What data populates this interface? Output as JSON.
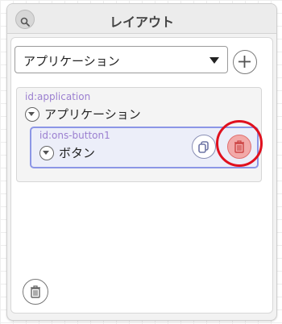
{
  "panel": {
    "title": "レイアウト",
    "search_icon": "search-icon"
  },
  "selector": {
    "selected": "アプリケーション",
    "add_icon": "plus-icon"
  },
  "tree": {
    "root": {
      "id_label": "id:application",
      "label": "アプリケーション"
    },
    "child": {
      "id_label": "id:ons-button1",
      "label": "ボタン",
      "copy_icon": "copy-icon",
      "delete_icon": "trash-icon"
    }
  },
  "footer": {
    "delete_icon": "trash-icon"
  },
  "colors": {
    "highlight_ring": "#e0101e",
    "selected_border": "#8c96e6",
    "id_text": "#9b7fd0",
    "delete_fill": "#f2a9a9"
  }
}
